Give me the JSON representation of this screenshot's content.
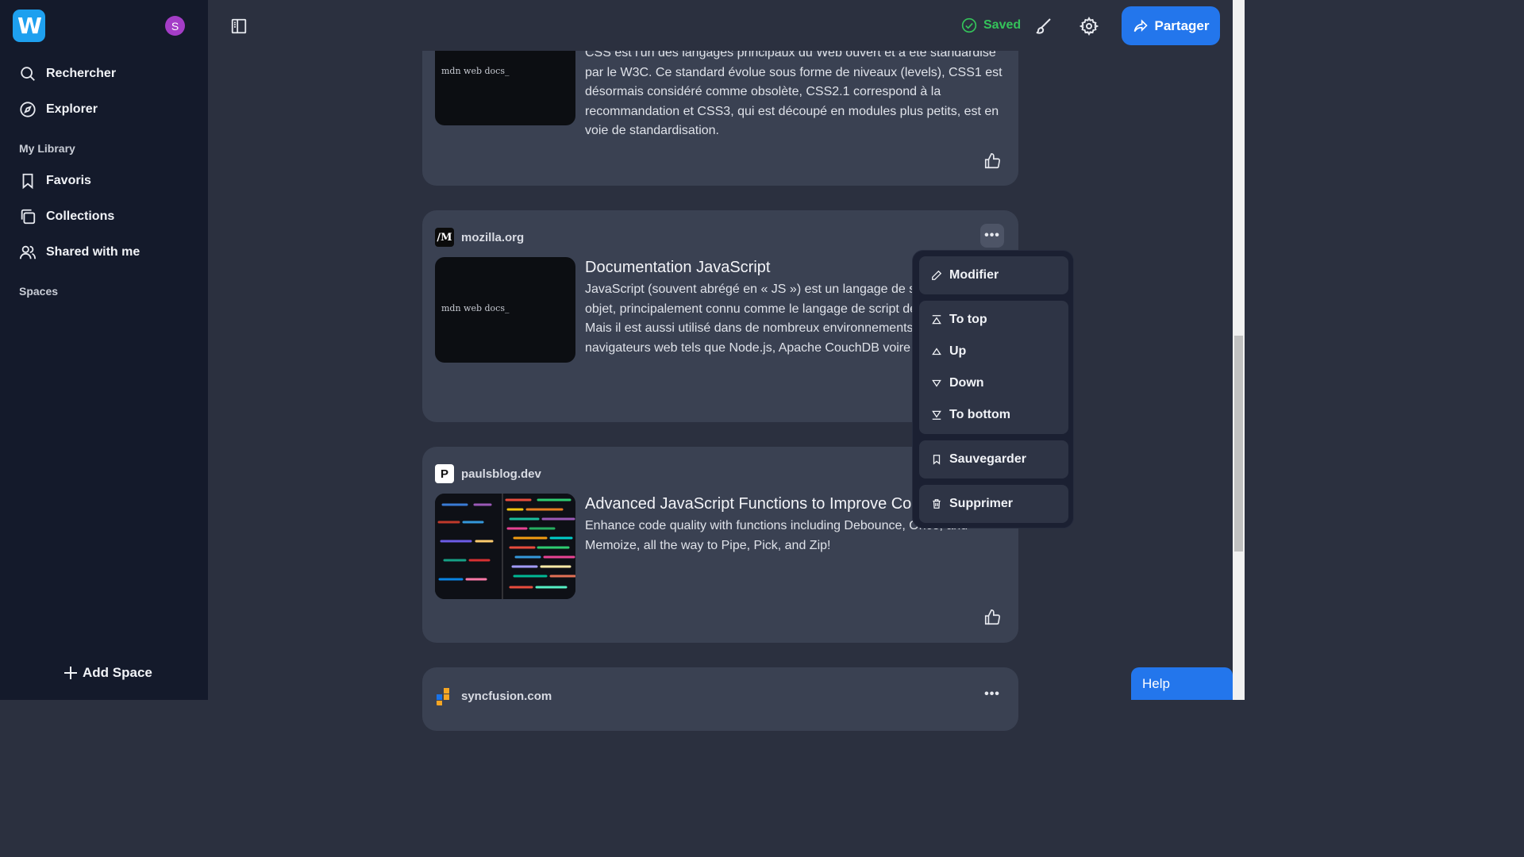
{
  "sidebar": {
    "logo_letter": "W",
    "avatar_letter": "S",
    "items": [
      {
        "label": "Rechercher",
        "icon": "search-icon"
      },
      {
        "label": "Explorer",
        "icon": "compass-icon"
      }
    ],
    "library_heading": "My Library",
    "library_items": [
      {
        "label": "Favoris",
        "icon": "bookmark-icon"
      },
      {
        "label": "Collections",
        "icon": "collections-icon"
      },
      {
        "label": "Shared with me",
        "icon": "users-icon"
      }
    ],
    "spaces_heading": "Spaces",
    "add_space_label": "Add Space"
  },
  "topbar": {
    "saved_label": "Saved",
    "share_label": "Partager"
  },
  "cards": [
    {
      "thumb_text": "mdn web docs_",
      "desc": "CSS est l'un des langages principaux du Web ouvert et a été standardisé par le W3C. Ce standard évolue sous forme de niveaux (levels), CSS1 est désormais considéré comme obsolète, CSS2.1 correspond à la recommandation et CSS3, qui est découpé en modules plus petits, est en voie de standardisation."
    },
    {
      "site": "mozilla.org",
      "favicon": "/M",
      "thumb_text": "mdn web docs_",
      "title": "Documentation JavaScript",
      "desc": "JavaScript (souvent abrégé en « JS ») est un langage de script orienté objet, principalement connu comme le langage de script des pages web. Mais il est aussi utilisé dans de nombreux environnements extérieurs aux navigateurs web tels que Node.js, Apache CouchDB voire Adobe Acrobat."
    },
    {
      "site": "paulsblog.dev",
      "favicon": "P",
      "title": "Advanced JavaScript Functions to Improve Code Quality",
      "desc": "Enhance code quality with functions including Debounce, Once, and Memoize, all the way to Pipe, Pick, and Zip!"
    },
    {
      "site": "syncfusion.com"
    }
  ],
  "menu": {
    "edit": "Modifier",
    "to_top": "To top",
    "up": "Up",
    "down": "Down",
    "to_bottom": "To bottom",
    "save": "Sauvegarder",
    "delete": "Supprimer"
  },
  "help_label": "Help",
  "colors": {
    "accent": "#2376ec",
    "saved_green": "#34c25a",
    "sidebar_bg": "#141a2b",
    "card_bg": "#3a4152"
  }
}
